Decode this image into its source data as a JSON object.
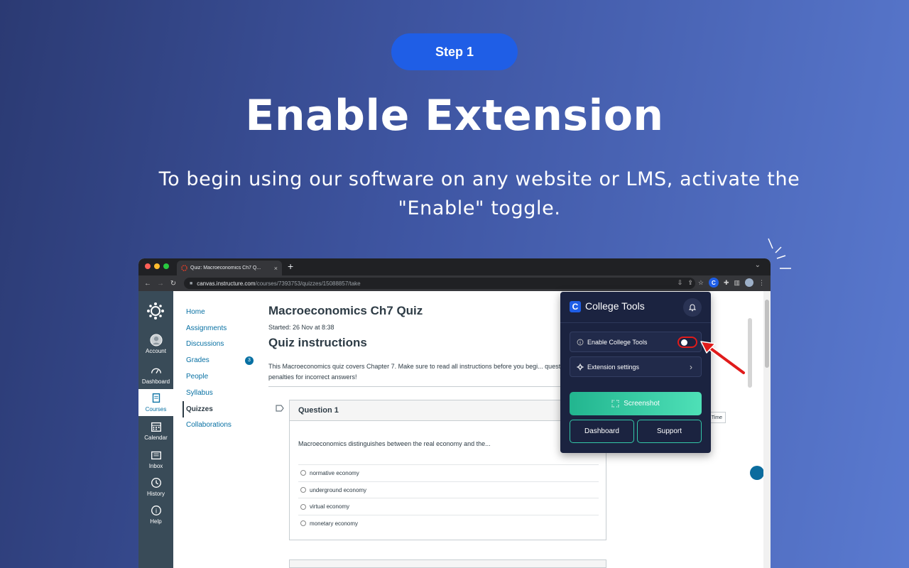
{
  "hero": {
    "step_label": "Step 1",
    "title": "Enable Extension",
    "subtitle": "To begin using our software on any website or LMS, activate the \"Enable\" toggle."
  },
  "browser": {
    "tab_title": "Quiz: Macroeconomics Ch7 Q...",
    "new_tab": "+",
    "close": "×",
    "url_host": "canvas.instructure.com",
    "url_path": "/courses/7393753/quizzes/15088857/take"
  },
  "global_nav": [
    {
      "label": "Account",
      "icon": "account-icon"
    },
    {
      "label": "Dashboard",
      "icon": "dashboard-icon"
    },
    {
      "label": "Courses",
      "icon": "courses-icon"
    },
    {
      "label": "Calendar",
      "icon": "calendar-icon"
    },
    {
      "label": "Inbox",
      "icon": "inbox-icon"
    },
    {
      "label": "History",
      "icon": "history-icon"
    },
    {
      "label": "Help",
      "icon": "help-icon"
    }
  ],
  "course_nav": {
    "items": [
      "Home",
      "Assignments",
      "Discussions",
      "Grades",
      "People",
      "Syllabus",
      "Quizzes",
      "Collaborations"
    ],
    "grades_badge": "3",
    "active": "Quizzes"
  },
  "quiz": {
    "title": "Macroeconomics Ch7 Quiz",
    "started": "Started: 26 Nov at 8:38",
    "instructions_heading": "Quiz instructions",
    "instructions_text": "This Macroeconomics quiz covers Chapter 7. Make sure to read all instructions before you begi... questions - no penalties for incorrect answers!",
    "question_label": "Question 1",
    "question_text": "Macroeconomics distinguishes between the real economy and the...",
    "answers": [
      "normative economy",
      "underground economy",
      "virtual economy",
      "monetary economy"
    ],
    "time_chip": "Time"
  },
  "extension": {
    "name": "College Tools",
    "logo_letter": "C",
    "enable_label": "Enable College Tools",
    "enabled": false,
    "settings_label": "Extension settings",
    "screenshot_label": "Screenshot",
    "dashboard_label": "Dashboard",
    "support_label": "Support",
    "accent_color": "#1f5ee6",
    "highlight_color": "#e01b1b"
  }
}
